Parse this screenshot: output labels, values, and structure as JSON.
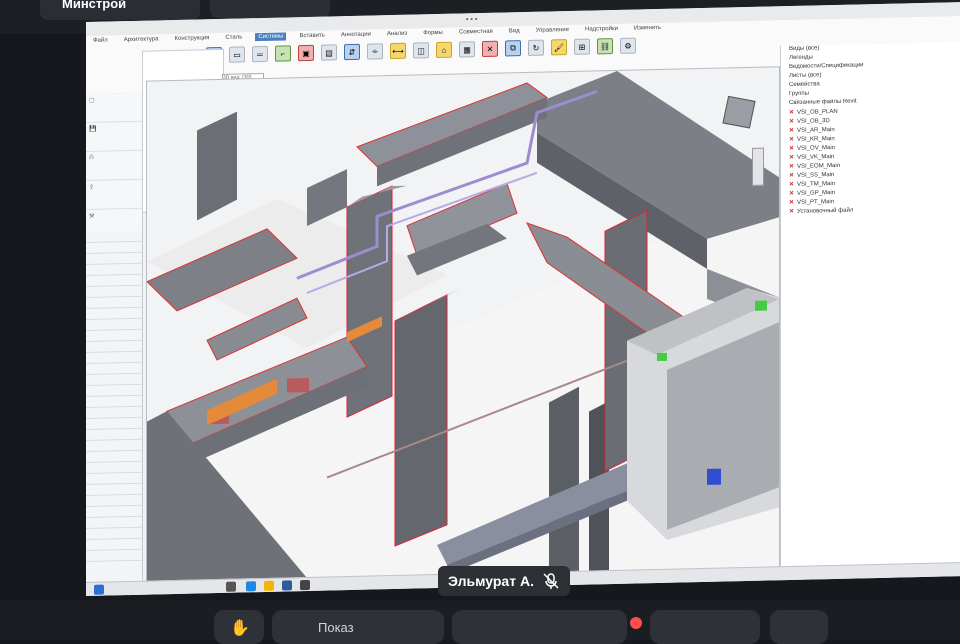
{
  "meeting": {
    "participant_top": "Минстрой",
    "speaker_name": "Эльмурат А.",
    "bottom_button_label": "Показ"
  },
  "app": {
    "ribbon_tabs": [
      "Файл",
      "Архитектура",
      "Конструкция",
      "Сталь",
      "Системы",
      "Вставить",
      "Аннотации",
      "Анализ",
      "Формы",
      "Совместная",
      "Вид",
      "Управление",
      "Надстройки",
      "Изменить"
    ],
    "viewport_tab": "3D вид: {3D}",
    "project_tree_rows": [
      "Виды (все)",
      "Легенды",
      "Ведомости/Спецификации",
      "Листы (все)",
      "Семейства",
      "Группы",
      "Связанные файлы Revit",
      "VSI_OB_PLAN",
      "VSI_OB_3D",
      "VSI_AR_Main",
      "VSI_KR_Main",
      "VSI_OV_Main",
      "VSI_VK_Main",
      "VSI_EOM_Main",
      "VSI_SS_Main",
      "VSI_TM_Main",
      "VSI_GP_Main",
      "VSI_PT_Main",
      "Установочный файл"
    ]
  },
  "colors": {
    "accent": "#4a7fc1",
    "duct": "#8e9199",
    "wall": "#6d7076",
    "outline": "#e33b3b",
    "pipe": "#9e8cd0",
    "floor": "#f0f0f0",
    "orange": "#e48a3a"
  },
  "icons": [
    "gesture-icon",
    "microphone-muted-icon",
    "share-icon",
    "view-cube-icon"
  ]
}
